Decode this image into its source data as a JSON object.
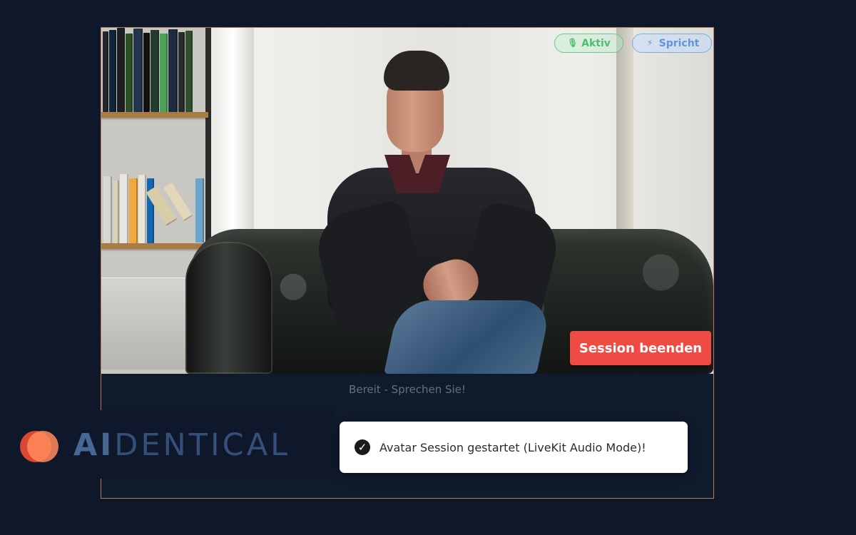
{
  "badges": {
    "active": {
      "label": "Aktiv",
      "icon": "microphone-icon"
    },
    "speaking": {
      "label": "Spricht",
      "icon": "bolt-icon"
    }
  },
  "video": {
    "end_session_label": "Session beenden",
    "status": "Bereit - Sprechen Sie!"
  },
  "brand": {
    "logo_prefix": "AI",
    "logo_suffix": "DENTICAL",
    "mark_colors": {
      "left": "#d94832",
      "right": "#ff8a5c"
    }
  },
  "toast": {
    "icon": "check-icon",
    "message": "Avatar Session gestartet (LiveKit Audio Mode)!"
  },
  "colors": {
    "background": "#0f182b",
    "panel_border": "#b87a55",
    "danger": "#ef4b45",
    "active": "#38b860",
    "speaking": "#4e8ce6"
  }
}
